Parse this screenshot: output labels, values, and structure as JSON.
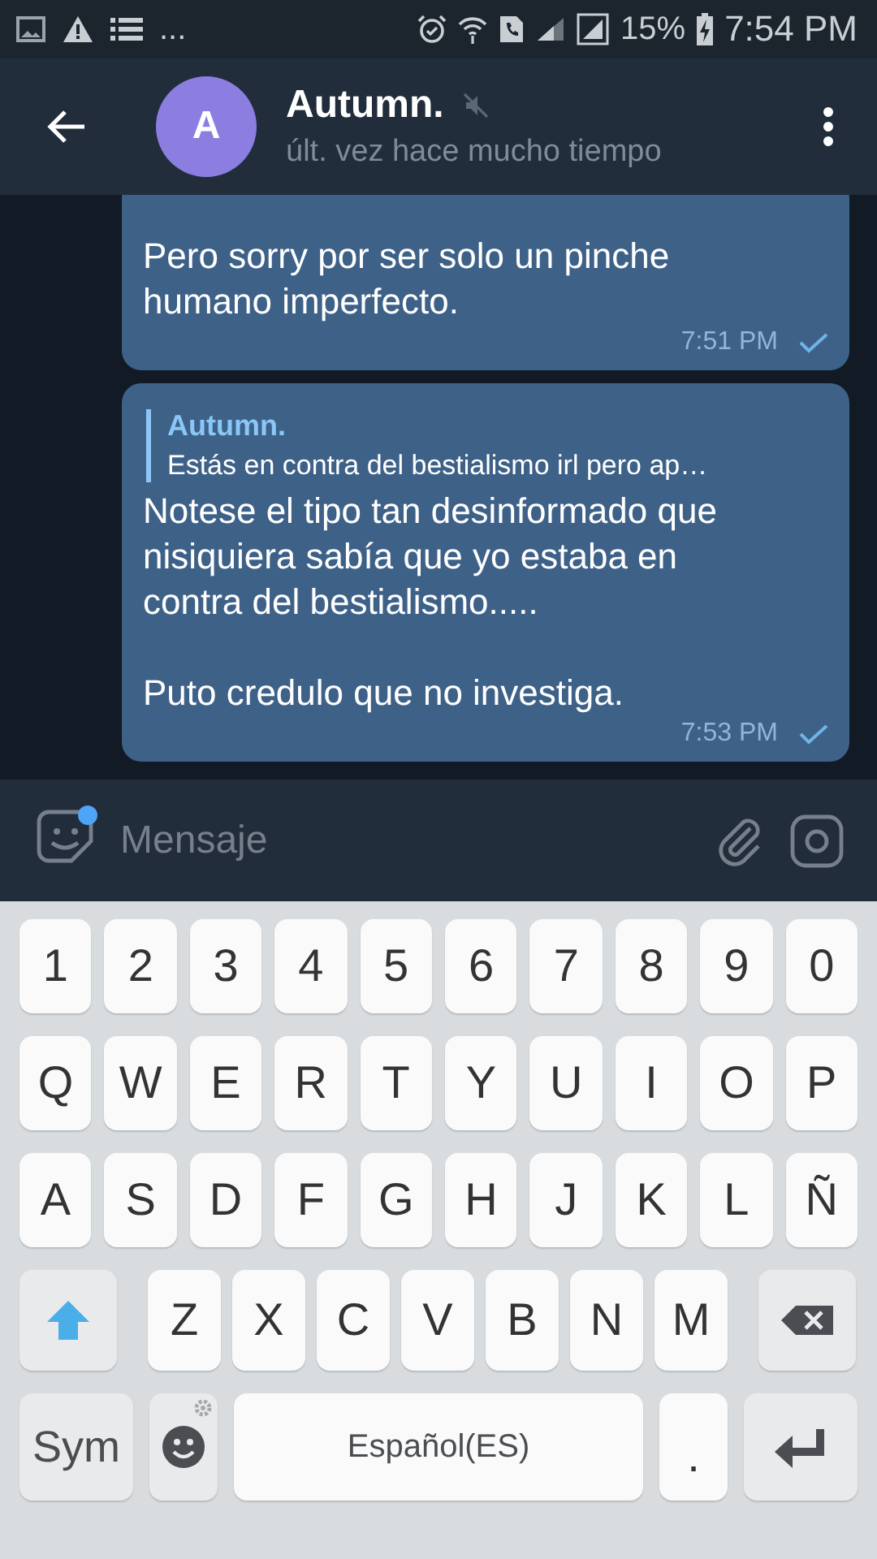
{
  "status_bar": {
    "more": "...",
    "battery": "15%",
    "time": "7:54 PM"
  },
  "header": {
    "avatar_letter": "A",
    "name": "Autumn.",
    "muted": true,
    "last_seen": "últ. vez hace mucho tiempo"
  },
  "messages": [
    {
      "text": "Pero sorry por ser solo un pinche humano imperfecto.",
      "time": "7:51 PM"
    },
    {
      "reply": {
        "author": "Autumn.",
        "text": "Estás en contra del bestialismo irl pero ap…"
      },
      "text": "Notese el tipo tan desinformado que nisiquiera sabía que yo estaba en contra del bestialismo.....\n\nPuto credulo que no investiga.",
      "time": "7:53 PM"
    }
  ],
  "composer": {
    "placeholder": "Mensaje"
  },
  "keyboard": [
    [
      {
        "kind": "char",
        "label": "1"
      },
      {
        "kind": "char",
        "label": "2"
      },
      {
        "kind": "char",
        "label": "3"
      },
      {
        "kind": "char",
        "label": "4"
      },
      {
        "kind": "char",
        "label": "5"
      },
      {
        "kind": "char",
        "label": "6"
      },
      {
        "kind": "char",
        "label": "7"
      },
      {
        "kind": "char",
        "label": "8"
      },
      {
        "kind": "char",
        "label": "9"
      },
      {
        "kind": "char",
        "label": "0"
      }
    ],
    [
      {
        "kind": "char",
        "label": "Q"
      },
      {
        "kind": "char",
        "label": "W"
      },
      {
        "kind": "char",
        "label": "E"
      },
      {
        "kind": "char",
        "label": "R"
      },
      {
        "kind": "char",
        "label": "T"
      },
      {
        "kind": "char",
        "label": "Y"
      },
      {
        "kind": "char",
        "label": "U"
      },
      {
        "kind": "char",
        "label": "I"
      },
      {
        "kind": "char",
        "label": "O"
      },
      {
        "kind": "char",
        "label": "P"
      }
    ],
    [
      {
        "kind": "char",
        "label": "A"
      },
      {
        "kind": "char",
        "label": "S"
      },
      {
        "kind": "char",
        "label": "D"
      },
      {
        "kind": "char",
        "label": "F"
      },
      {
        "kind": "char",
        "label": "G"
      },
      {
        "kind": "char",
        "label": "H"
      },
      {
        "kind": "char",
        "label": "J"
      },
      {
        "kind": "char",
        "label": "K"
      },
      {
        "kind": "char",
        "label": "L"
      },
      {
        "kind": "char",
        "label": "Ñ"
      }
    ],
    [
      {
        "kind": "shift"
      },
      {
        "kind": "char",
        "label": "Z"
      },
      {
        "kind": "char",
        "label": "X"
      },
      {
        "kind": "char",
        "label": "C"
      },
      {
        "kind": "char",
        "label": "V"
      },
      {
        "kind": "char",
        "label": "B"
      },
      {
        "kind": "char",
        "label": "N"
      },
      {
        "kind": "char",
        "label": "M"
      },
      {
        "kind": "backspace"
      }
    ],
    [
      {
        "kind": "sym",
        "label": "Sym"
      },
      {
        "kind": "emoji"
      },
      {
        "kind": "space",
        "label": "Español(ES)"
      },
      {
        "kind": "dot",
        "label": "."
      },
      {
        "kind": "enter"
      }
    ]
  ]
}
